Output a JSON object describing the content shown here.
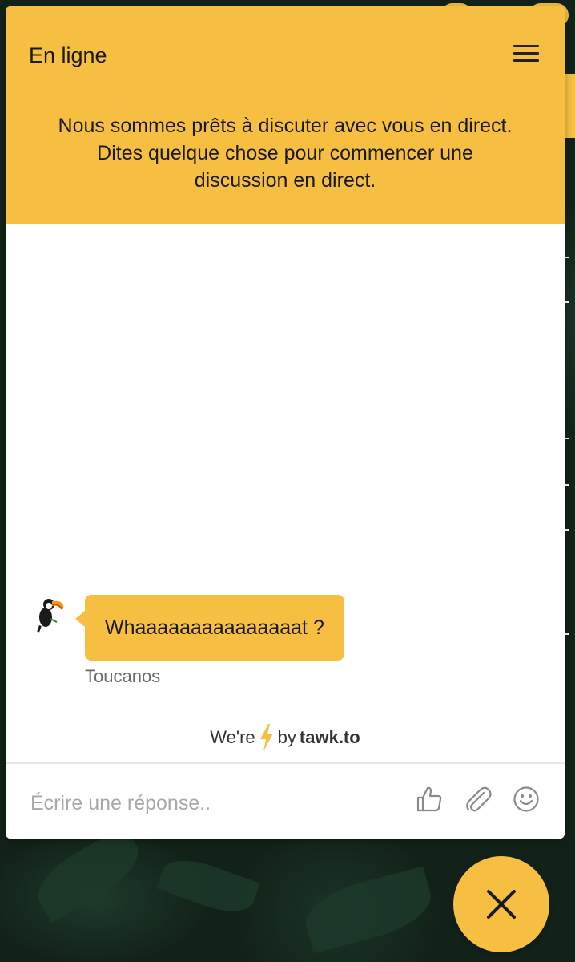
{
  "header": {
    "status": "En ligne",
    "welcome_line1": "Nous sommes prêts à discuter avec vous en direct.",
    "welcome_line2": "Dites quelque chose pour commencer une",
    "welcome_line3": "discussion en direct."
  },
  "messages": [
    {
      "text": "Whaaaaaaaaaaaaaaat ?",
      "sender": "Toucanos"
    }
  ],
  "footer": {
    "powered_prefix": "We're",
    "powered_middle": "by",
    "powered_brand": "tawk.to"
  },
  "composer": {
    "placeholder": "Écrire une réponse.."
  },
  "colors": {
    "accent": "#f6bf41",
    "background": "#132219"
  },
  "icons": {
    "menu": "hamburger-menu-icon",
    "like": "thumbs-up-icon",
    "attach": "paperclip-icon",
    "emoji": "smiley-icon",
    "close": "close-icon",
    "bolt": "lightning-bolt-icon",
    "avatar": "toucan-avatar-icon"
  }
}
